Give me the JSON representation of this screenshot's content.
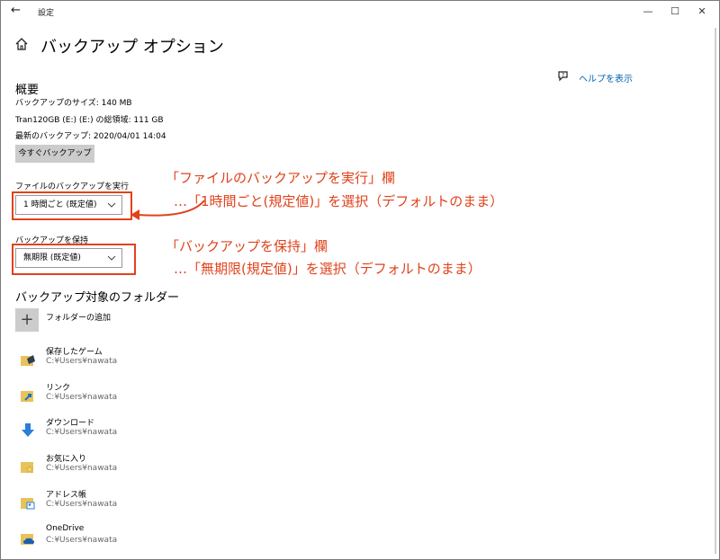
{
  "window": {
    "title": "設定",
    "back": "←",
    "minimize": "—",
    "maximize": "☐",
    "close": "✕"
  },
  "page": {
    "title": "バックアップ オプション",
    "help_link": "ヘルプを表示"
  },
  "overview": {
    "heading": "概要",
    "size": "バックアップのサイズ: 140 MB",
    "drive": "Tran120GB (E:) (E:) の総領域: 111 GB",
    "latest": "最新のバックアップ: 2020/04/01 14:04",
    "backup_now": "今すぐバックアップ"
  },
  "run_backup": {
    "label": "ファイルのバックアップを実行",
    "value": "1 時間ごと (既定値)"
  },
  "keep_backup": {
    "label": "バックアップを保持",
    "value": "無期限 (既定値)"
  },
  "folders": {
    "heading": "バックアップ対象のフォルダー",
    "add_label": "フォルダーの追加",
    "items": [
      {
        "name": "保存したゲーム",
        "path": "C:¥Users¥nawata",
        "icon": "saved-games-folder-icon"
      },
      {
        "name": "リンク",
        "path": "C:¥Users¥nawata",
        "icon": "links-folder-icon"
      },
      {
        "name": "ダウンロード",
        "path": "C:¥Users¥nawata",
        "icon": "downloads-icon"
      },
      {
        "name": "お気に入り",
        "path": "C:¥Users¥nawata",
        "icon": "favorites-folder-icon"
      },
      {
        "name": "アドレス帳",
        "path": "C:¥Users¥nawata",
        "icon": "contacts-folder-icon"
      },
      {
        "name": "OneDrive",
        "path": "C:¥Users¥nawata",
        "icon": "onedrive-folder-icon"
      }
    ]
  },
  "annotations": {
    "run_title": "「ファイルのバックアップを実行」欄",
    "run_detail": "…「1時間ごと(規定値)」を選択（デフォルトのまま）",
    "keep_title": "「バックアップを保持」欄",
    "keep_detail": "…「無期限(規定値)」を選択（デフォルトのまま）",
    "color": "#e0421b"
  }
}
